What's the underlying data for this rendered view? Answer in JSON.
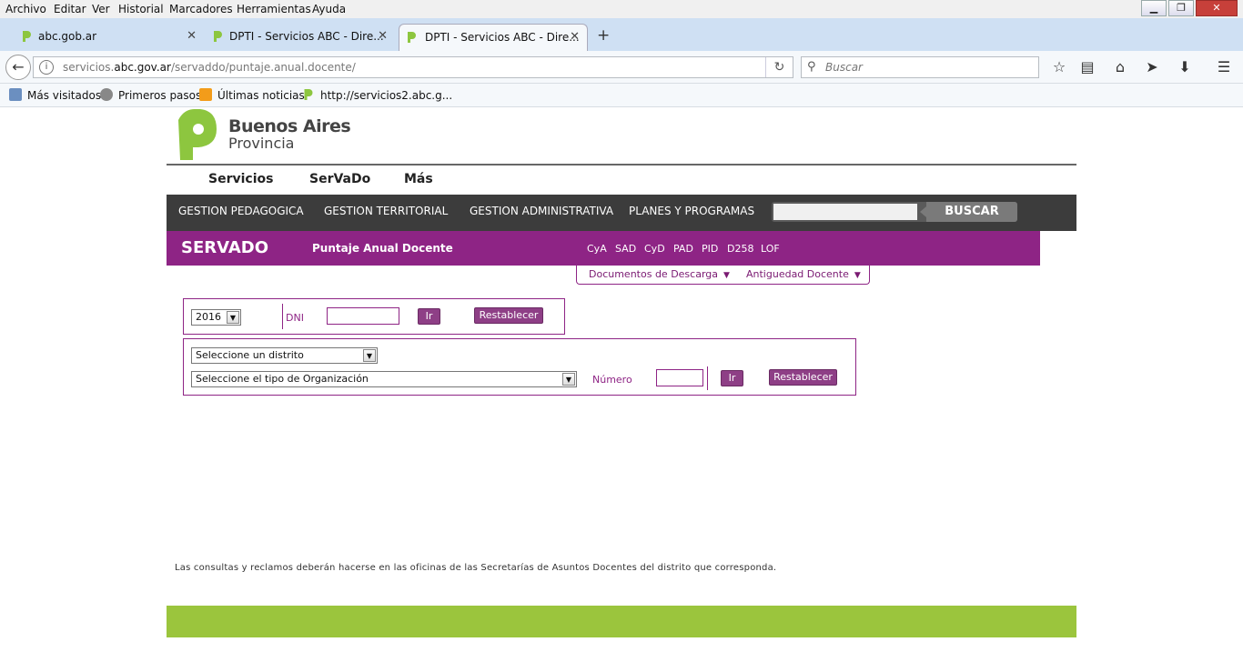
{
  "browser": {
    "menu": [
      "Archivo",
      "Editar",
      "Ver",
      "Historial",
      "Marcadores",
      "Herramientas",
      "Ayuda"
    ],
    "window_controls": {
      "minimize": "▁",
      "maximize": "❐",
      "close": "✕"
    },
    "tabs": [
      {
        "label": "abc.gob.ar",
        "active": false
      },
      {
        "label": "DPTI - Servicios ABC - Dire...",
        "active": false
      },
      {
        "label": "DPTI - Servicios ABC - Dire...",
        "active": true
      }
    ],
    "new_tab": "+",
    "url": {
      "prefix": "servicios.",
      "domain": "abc.gov.ar",
      "path": "/servaddo/puntaje.anual.docente/"
    },
    "search_placeholder": "Buscar",
    "bookmarks": [
      {
        "label": "Más visitados",
        "icon": "most-visited-icon"
      },
      {
        "label": "Primeros pasos",
        "icon": "globe-icon"
      },
      {
        "label": "Últimas noticias",
        "icon": "rss-icon"
      },
      {
        "label": "http://servicios2.abc.g...",
        "icon": "pba-leaf-icon"
      }
    ]
  },
  "brand": {
    "line1": "Buenos Aires",
    "line2": "Provincia",
    "green": "#8dc63f"
  },
  "main_nav": [
    "Servicios",
    "SerVaDo",
    "Más"
  ],
  "dark_nav": [
    "GESTION PEDAGOGICA",
    "GESTION TERRITORIAL",
    "GESTION ADMINISTRATIVA",
    "PLANES Y PROGRAMAS"
  ],
  "dark_search_button": "BUSCAR",
  "servado": {
    "title": "SERVADO",
    "subtitle": "Puntaje Anual Docente",
    "links": [
      "CyA",
      "SAD",
      "CyD",
      "PAD",
      "PID",
      "D258",
      "LOF"
    ],
    "dropdown_menus": [
      "Documentos de Descarga",
      "Antiguedad Docente"
    ],
    "dropdown_arrow": "▼",
    "accent": "#8e2485"
  },
  "form1": {
    "year": "2016",
    "dni_label": "DNI",
    "go": "Ir",
    "reset": "Restablecer"
  },
  "form2": {
    "distrito": "Seleccione un distrito",
    "tipo": "Seleccione el tipo de Organización",
    "numero_label": "Número",
    "go": "Ir",
    "reset": "Restablecer"
  },
  "note": "Las consultas y reclamos deberán hacerse en las oficinas de las Secretarías de Asuntos Docentes del distrito que corresponda.",
  "footer_color": "#9bc53d"
}
